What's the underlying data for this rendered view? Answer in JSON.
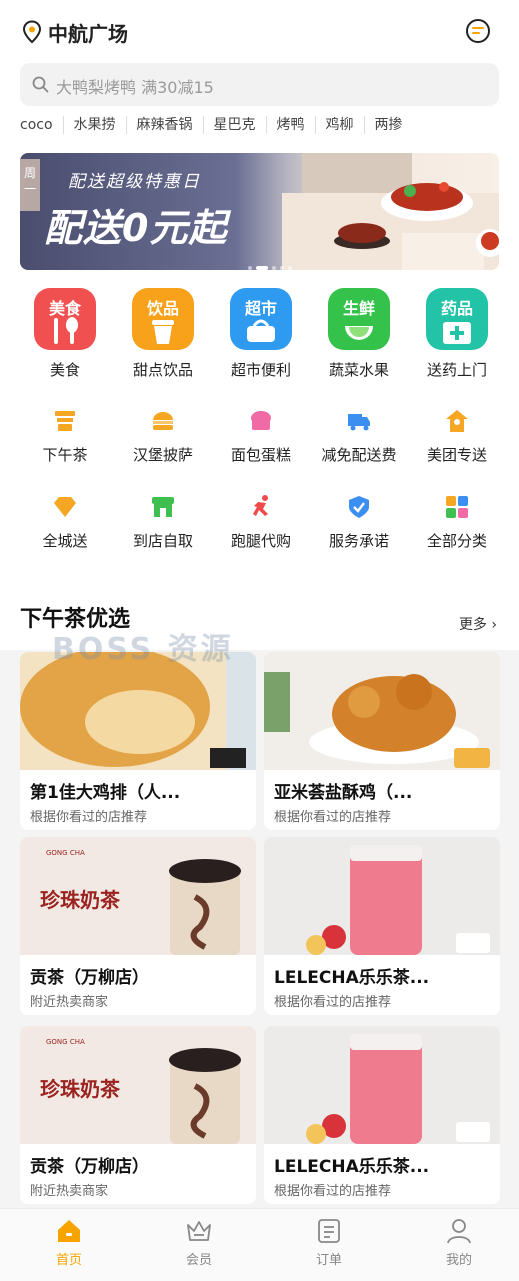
{
  "header": {
    "location": "中航广场",
    "location_icon": "location-pin-icon",
    "message_icon": "message-icon"
  },
  "search": {
    "placeholder": "大鸭梨烤鸭 满30减15"
  },
  "hot_tags": [
    "coco",
    "水果捞",
    "麻辣香锅",
    "星巴克",
    "烤鸭",
    "鸡柳",
    "两掺"
  ],
  "banner": {
    "side_tag": "周一",
    "subtitle": "配送超级特惠日",
    "headline": "配送0元起"
  },
  "main_categories": [
    {
      "tile_text": "美食",
      "label": "美食",
      "color": "#f0504f",
      "icon": "fork-spoon-icon"
    },
    {
      "tile_text": "饮品",
      "label": "甜点饮品",
      "color": "#f7a21a",
      "icon": "drink-cup-icon"
    },
    {
      "tile_text": "超市",
      "label": "超市便利",
      "color": "#2f9bf0",
      "icon": "basket-icon"
    },
    {
      "tile_text": "生鲜",
      "label": "蔬菜水果",
      "color": "#35c24a",
      "icon": "lime-icon"
    },
    {
      "tile_text": "药品",
      "label": "送药上门",
      "color": "#22c3a7",
      "icon": "medicine-box-icon"
    }
  ],
  "sub_categories": [
    {
      "label": "下午茶",
      "icon": "tea-cup-icon",
      "color": "#f5a623"
    },
    {
      "label": "汉堡披萨",
      "icon": "burger-icon",
      "color": "#f5a623"
    },
    {
      "label": "面包蛋糕",
      "icon": "cake-icon",
      "color": "#f06aa6"
    },
    {
      "label": "减免配送费",
      "icon": "delivery-truck-icon",
      "color": "#3b8ff0"
    },
    {
      "label": "美团专送",
      "icon": "rider-icon",
      "color": "#f5a623"
    },
    {
      "label": "全城送",
      "icon": "diamond-icon",
      "color": "#f5a623"
    },
    {
      "label": "到店自取",
      "icon": "store-icon",
      "color": "#3fbf4f"
    },
    {
      "label": "跑腿代购",
      "icon": "running-man-icon",
      "color": "#f04a4a"
    },
    {
      "label": "服务承诺",
      "icon": "shield-check-icon",
      "color": "#3b8ff0"
    },
    {
      "label": "全部分类",
      "icon": "grid-icon",
      "color": "#f5a623"
    }
  ],
  "section": {
    "title": "下午茶优选",
    "more": "更多 ›",
    "watermark": "BOSS 资源"
  },
  "cards": [
    {
      "title": "第1佳大鸡排（人...",
      "subtitle": "根据你看过的店推荐",
      "image": "fried-chicken-cutlet"
    },
    {
      "title": "亚米荟盐酥鸡（...",
      "subtitle": "根据你看过的店推荐",
      "image": "popcorn-chicken"
    },
    {
      "title": "贡茶（万柳店）",
      "subtitle": "附近热卖商家",
      "image": "pearl-milk-tea",
      "image_caption": "珍珠奶茶",
      "image_brand": "GONG CHA"
    },
    {
      "title": "LELECHA乐乐茶...",
      "subtitle": "根据你看过的店推荐",
      "image": "strawberry-drink"
    },
    {
      "title": "贡茶（万柳店）",
      "subtitle": "附近热卖商家",
      "image": "pearl-milk-tea",
      "image_caption": "珍珠奶茶",
      "image_brand": "GONG CHA"
    },
    {
      "title": "LELECHA乐乐茶...",
      "subtitle": "根据你看过的店推荐",
      "image": "strawberry-drink"
    }
  ],
  "tabbar": [
    {
      "label": "首页",
      "icon": "home-icon",
      "active": true
    },
    {
      "label": "会员",
      "icon": "crown-icon",
      "active": false
    },
    {
      "label": "订单",
      "icon": "order-list-icon",
      "active": false
    },
    {
      "label": "我的",
      "icon": "profile-icon",
      "active": false
    }
  ],
  "colors": {
    "accent": "#f7a400",
    "text": "#222222",
    "muted": "#888888"
  }
}
